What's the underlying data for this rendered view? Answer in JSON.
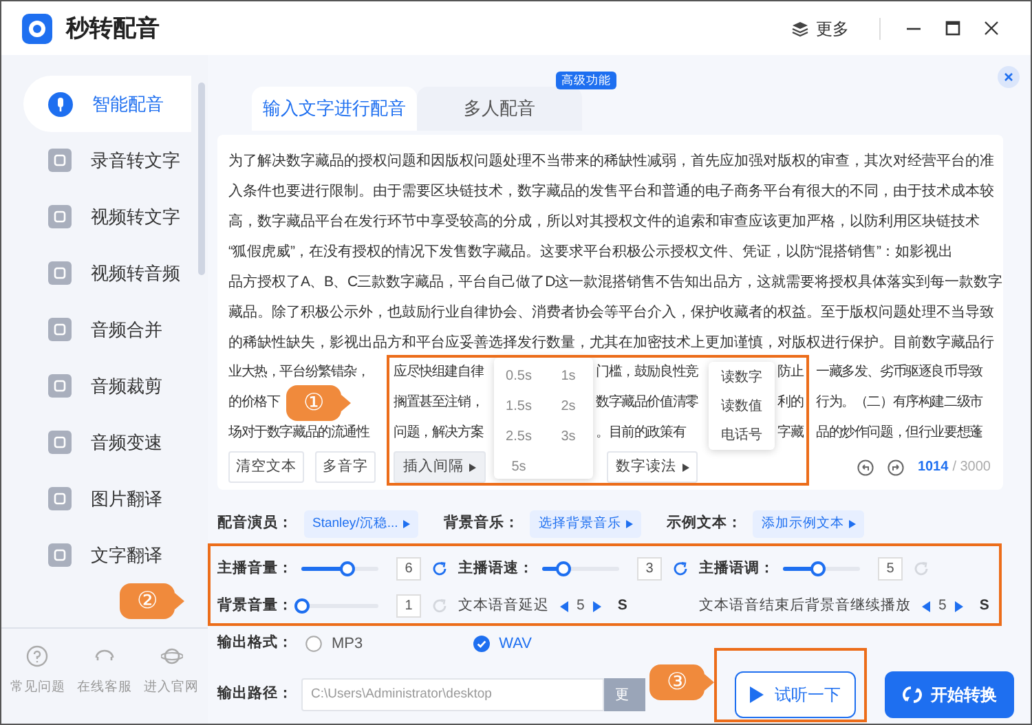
{
  "app": {
    "title": "秒转配音",
    "more": "更多"
  },
  "sidebar": {
    "items": [
      {
        "label": "智能配音",
        "selected": true
      },
      {
        "label": "录音转文字",
        "selected": false
      },
      {
        "label": "视频转文字",
        "selected": false
      },
      {
        "label": "视频转音频",
        "selected": false
      },
      {
        "label": "音频合并",
        "selected": false
      },
      {
        "label": "音频裁剪",
        "selected": false
      },
      {
        "label": "音频变速",
        "selected": false
      },
      {
        "label": "图片翻译",
        "selected": false
      },
      {
        "label": "文字翻译",
        "selected": false
      }
    ],
    "footer": [
      {
        "label": "常见问题"
      },
      {
        "label": "在线客服"
      },
      {
        "label": "进入官网"
      }
    ]
  },
  "tabs": [
    {
      "label": "输入文字进行配音",
      "selected": true
    },
    {
      "label": "多人配音",
      "selected": false
    }
  ],
  "badge": "高级功能",
  "editor": {
    "lines": [
      [
        "为了解决数字藏品的授权问题和因版权问题处理不当带来的稀缺性减弱，首先应加强对版权的审查，其次对经营平台的准"
      ],
      [
        "入条件也要进行限制。由于需要区块链技术，数字藏品的发售平台和普通的电子商务平台有很大的不同，由于技术成本较"
      ],
      [
        "高，数字藏品平台在发行环节中享受较高的分成，所以对其授权文件的追索和审查应该更加严格，以防利用区块链技术"
      ],
      [
        "“狐假虎威”，在没有授权的情况下发售数字藏品。这要求平台积极公示授权文件、凭证，以防“混搭销售”：如影视出"
      ],
      [
        "品方授权了A、B、C三款数字藏品，平台自己做了D这一款混搭销售不告知出品方，这就需要将授权具体落实到每一款数字"
      ],
      [
        "藏品。除了积极公示外，也鼓励行业自律协会、消费者协会等平台介入，保护收藏者的权益。至于版权问题处理不当导致"
      ],
      [
        "的稀缺性缺失，影视出品方和平台应妥善选择发行数量，尤其在加密技术上更加谨慎，对版权进行保护。目前数字藏品行"
      ],
      [
        "业大热，平台纷繁错杂，",
        "应尽快组建自律",
        "门槛，鼓励良性竞",
        "防止",
        "一藏多发、劣币驱逐良币导致"
      ],
      [
        "的价格下",
        "搁置甚至注销，",
        "数字藏品价值清零",
        "利的",
        "行为。（二）有序构建二级市"
      ],
      [
        "场对于数字藏品的流通性",
        "问题，解决方案",
        "。目前的政策有",
        "字藏",
        "品的炒作问题，但行业要想蓬"
      ]
    ],
    "buttons": [
      {
        "label": "清空文本",
        "menu": false,
        "selected": false
      },
      {
        "label": "多音字",
        "menu": false,
        "selected": false
      },
      {
        "label": "插入间隔",
        "menu": true,
        "selected": true
      },
      {
        "label": "数字读法",
        "menu": true,
        "selected": false
      }
    ],
    "interval_menu": [
      "0.5s",
      "1s",
      "1.5s",
      "2s",
      "2.5s",
      "3s",
      "5s"
    ],
    "number_menu": [
      "读数字",
      "读数值",
      "电话号"
    ],
    "count": "1014",
    "limit": "/ 3000"
  },
  "pickers": [
    {
      "label": "配音演员：",
      "value": "Stanley/沉稳..."
    },
    {
      "label": "背景音乐：",
      "value": "选择背景音乐"
    },
    {
      "label": "示例文本：",
      "value": "添加示例文本"
    }
  ],
  "settings": [
    {
      "kind": "slider",
      "label": "主播音量：",
      "level": 0.6,
      "value": "6",
      "reset_enabled": true
    },
    {
      "kind": "slider",
      "label": "主播语速：",
      "level": 0.27,
      "value": "3",
      "reset_enabled": true
    },
    {
      "kind": "slider",
      "label": "主播语调：",
      "level": 0.45,
      "value": "5",
      "reset_enabled": false
    },
    {
      "kind": "slider",
      "label": "背景音量：",
      "level": 0,
      "value": "1",
      "reset_enabled": false
    },
    {
      "kind": "stepper",
      "label": "文本语音延迟",
      "value": "5",
      "unit": "S"
    },
    {
      "kind": "stepper",
      "label": "文本语音结束后背景音继续播放",
      "value": "5",
      "unit": "S"
    }
  ],
  "output": {
    "format_label": "输出格式：",
    "formats": [
      {
        "label": "MP3",
        "selected": false
      },
      {
        "label": "WAV",
        "selected": true
      }
    ],
    "path_label": "输出路径：",
    "path": "C:\\Users\\Administrator\\desktop",
    "browse": "更"
  },
  "actions": [
    {
      "kind": "outline",
      "label": "试听一下"
    },
    {
      "kind": "primary",
      "label": "开始转换"
    }
  ],
  "annotations": [
    "①",
    "②",
    "③"
  ]
}
